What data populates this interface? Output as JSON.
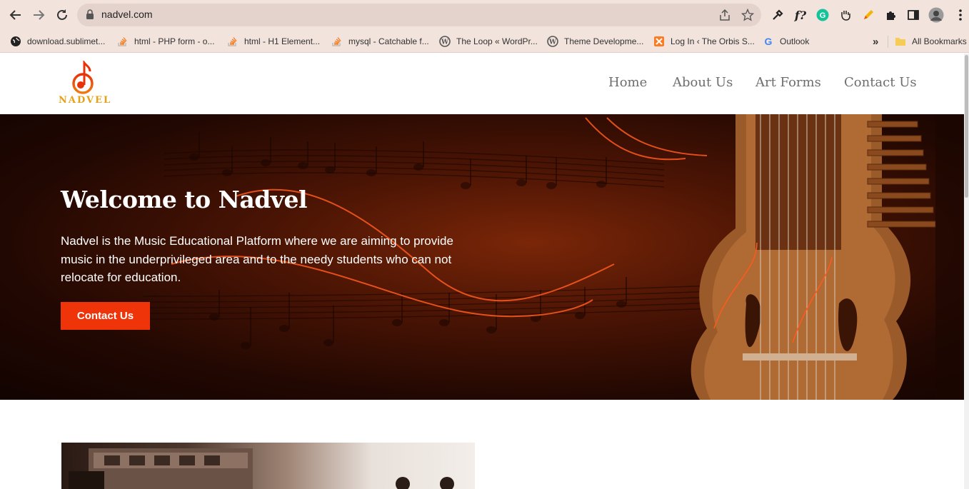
{
  "browser": {
    "url": "nadvel.com",
    "bookmarks": [
      {
        "label": "download.sublimet...",
        "icon": "globe-icon"
      },
      {
        "label": "html - PHP form - o...",
        "icon": "stackoverflow-icon"
      },
      {
        "label": "html - H1 Element...",
        "icon": "stackoverflow-icon"
      },
      {
        "label": "mysql - Catchable f...",
        "icon": "stackoverflow-icon"
      },
      {
        "label": "The Loop « WordPr...",
        "icon": "wordpress-icon"
      },
      {
        "label": "Theme Developme...",
        "icon": "wordpress-icon"
      },
      {
        "label": "Log In ‹ The Orbis S...",
        "icon": "xampp-icon"
      },
      {
        "label": "Outlook",
        "icon": "google-icon"
      }
    ],
    "overflow_label": "»",
    "all_bookmarks_label": "All Bookmarks"
  },
  "site": {
    "logo_text": "NADVEL",
    "menu": [
      {
        "label": "Home"
      },
      {
        "label": "About Us"
      },
      {
        "label": "Art Forms"
      },
      {
        "label": "Contact Us"
      }
    ]
  },
  "hero": {
    "title": "Welcome to Nadvel",
    "description": "Nadvel is the Music Educational Platform where we are aiming to provide music in the underprivileged area and to the needy students who can not relocate for education.",
    "button_label": "Contact Us"
  },
  "colors": {
    "accent": "#f0340a",
    "logo": "#e3a21a",
    "chrome": "#f2e3dd"
  }
}
